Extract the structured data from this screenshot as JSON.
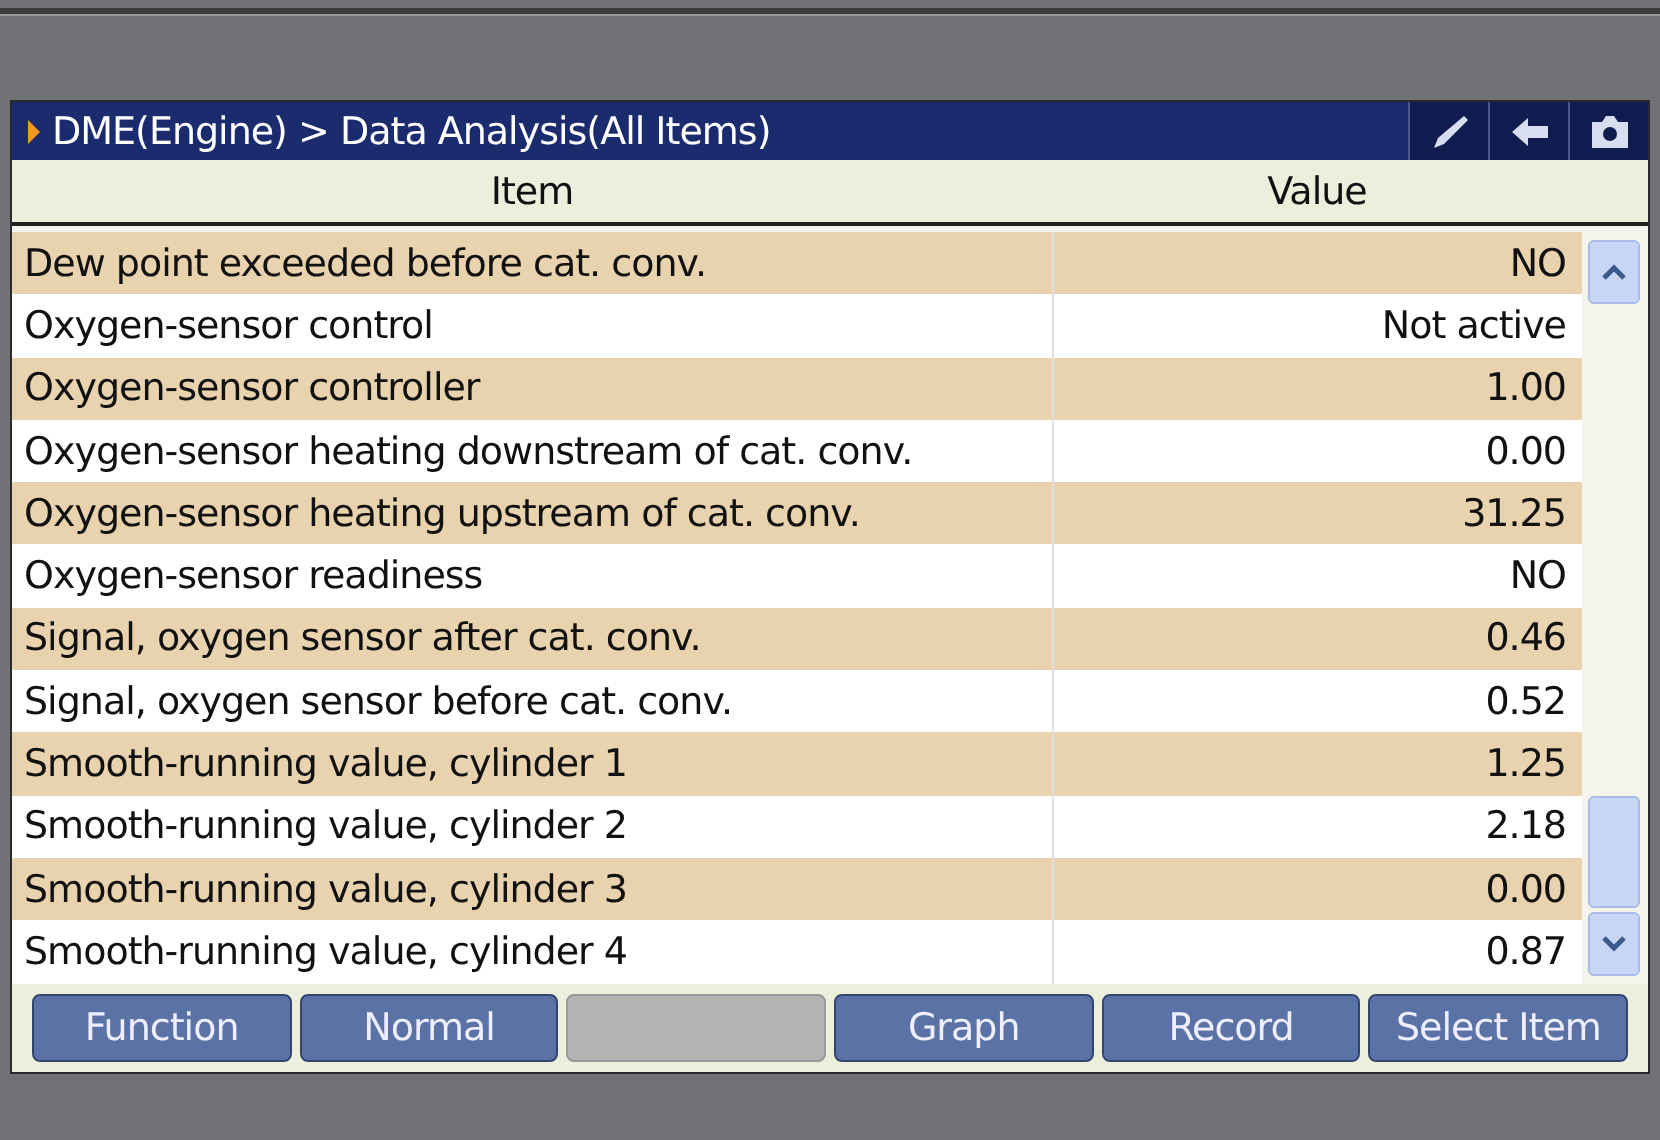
{
  "window": {
    "title": "DME(Engine) > Data Analysis(All Items)"
  },
  "table": {
    "columns": [
      "Item",
      "Value"
    ],
    "rows": [
      {
        "item": "Dew point exceeded before cat. conv.",
        "value": "NO"
      },
      {
        "item": "Oxygen-sensor control",
        "value": "Not active"
      },
      {
        "item": "Oxygen-sensor controller",
        "value": "1.00"
      },
      {
        "item": "Oxygen-sensor heating downstream of cat. conv.",
        "value": "0.00"
      },
      {
        "item": "Oxygen-sensor heating upstream of cat. conv.",
        "value": "31.25"
      },
      {
        "item": "Oxygen-sensor readiness",
        "value": "NO"
      },
      {
        "item": "Signal, oxygen sensor after cat. conv.",
        "value": "0.46"
      },
      {
        "item": "Signal, oxygen sensor before cat. conv.",
        "value": "0.52"
      },
      {
        "item": "Smooth-running value, cylinder 1",
        "value": "1.25"
      },
      {
        "item": "Smooth-running value, cylinder 2",
        "value": "2.18"
      },
      {
        "item": "Smooth-running value, cylinder 3",
        "value": "0.00"
      },
      {
        "item": "Smooth-running value, cylinder 4",
        "value": "0.87"
      }
    ]
  },
  "buttons": [
    {
      "label": "Function",
      "disabled": false
    },
    {
      "label": "Normal",
      "disabled": false
    },
    {
      "disabled": true
    },
    {
      "label": "Graph",
      "disabled": false
    },
    {
      "label": "Record",
      "disabled": false
    },
    {
      "label": "Select Item",
      "disabled": false
    }
  ]
}
